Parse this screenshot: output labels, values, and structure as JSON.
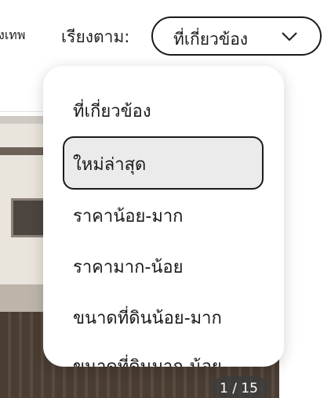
{
  "header": {
    "location_fragment": "ุงเทพ",
    "sort_label": "เรียงตาม:",
    "sort_value": "ที่เกี่ยวข้อง"
  },
  "sort_menu": {
    "options": [
      "ที่เกี่ยวข้อง",
      "ใหม่ล่าสุด",
      "ราคาน้อย-มาก",
      "ราคามาก-น้อย",
      "ขนาดที่ดินน้อย-มาก",
      "ขนาดที่ดินมาก-น้อย"
    ],
    "highlighted_index": 1
  },
  "listing": {
    "photo_counter": "1 / 15"
  }
}
